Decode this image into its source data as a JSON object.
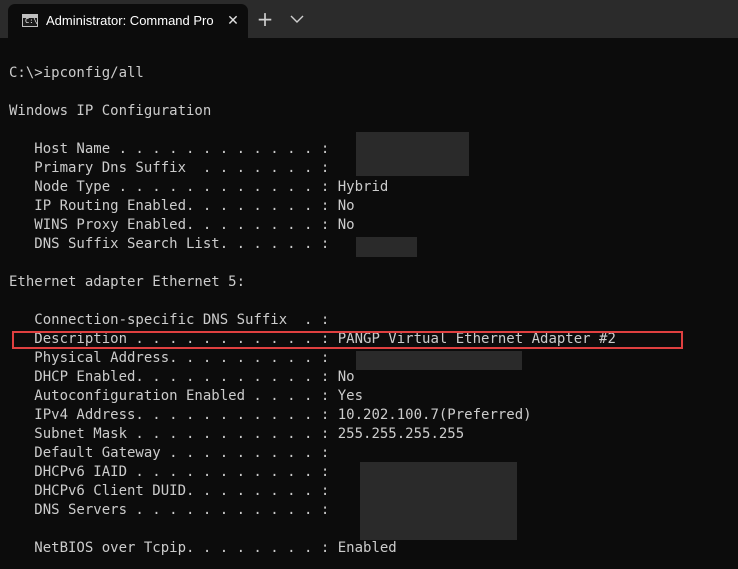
{
  "window": {
    "tab_title": "Administrator: Command Prompt",
    "tab_icon_text": "C:\\",
    "close_glyph": "✕",
    "new_tab_glyph": "+"
  },
  "terminal": {
    "prompt": "C:\\>ipconfig/all",
    "heading": "Windows IP Configuration",
    "ip_config": [
      {
        "label": "   Host Name . . . . . . . . . . . . : ",
        "value": ""
      },
      {
        "label": "   Primary Dns Suffix  . . . . . . . : ",
        "value": ""
      },
      {
        "label": "   Node Type . . . . . . . . . . . . : ",
        "value": "Hybrid"
      },
      {
        "label": "   IP Routing Enabled. . . . . . . . : ",
        "value": "No"
      },
      {
        "label": "   WINS Proxy Enabled. . . . . . . . : ",
        "value": "No"
      },
      {
        "label": "   DNS Suffix Search List. . . . . . : ",
        "value": ""
      }
    ],
    "adapter_heading": "Ethernet adapter Ethernet 5:",
    "adapter": [
      {
        "label": "   Connection-specific DNS Suffix  . : ",
        "value": ""
      },
      {
        "label": "   Description . . . . . . . . . . . : ",
        "value": "PANGP Virtual Ethernet Adapter #2"
      },
      {
        "label": "   Physical Address. . . . . . . . . : ",
        "value": ""
      },
      {
        "label": "   DHCP Enabled. . . . . . . . . . . : ",
        "value": "No"
      },
      {
        "label": "   Autoconfiguration Enabled . . . . : ",
        "value": "Yes"
      },
      {
        "label": "   IPv4 Address. . . . . . . . . . . : ",
        "value": "10.202.100.7(Preferred)"
      },
      {
        "label": "   Subnet Mask . . . . . . . . . . . : ",
        "value": "255.255.255.255"
      },
      {
        "label": "   Default Gateway . . . . . . . . . : ",
        "value": ""
      },
      {
        "label": "   DHCPv6 IAID . . . . . . . . . . . : ",
        "value": ""
      },
      {
        "label": "   DHCPv6 Client DUID. . . . . . . . : ",
        "value": ""
      },
      {
        "label": "   DNS Servers . . . . . . . . . . . : ",
        "value": ""
      }
    ],
    "netbios": {
      "label": "   NetBIOS over Tcpip. . . . . . . . : ",
      "value": "Enabled"
    }
  },
  "colors": {
    "terminal_bg": "#0c0c0c",
    "terminal_text": "#cccccc",
    "titlebar_bg": "#2b2b2b",
    "highlight_border": "#e04040",
    "redaction": "#2a2a2a"
  }
}
